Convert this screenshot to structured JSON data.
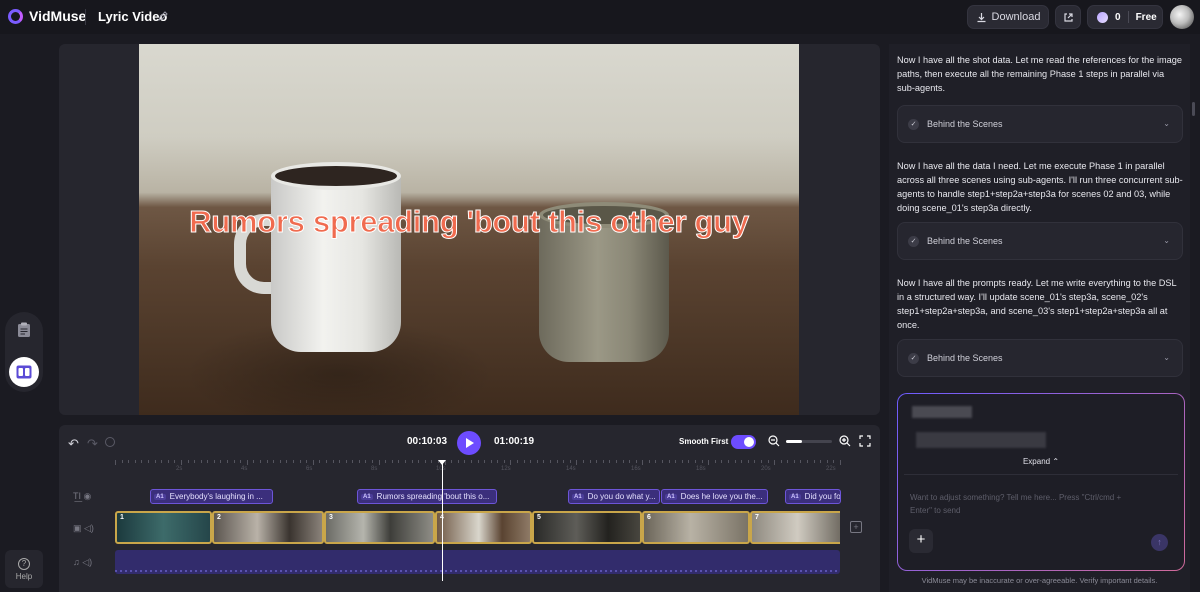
{
  "app": {
    "name": "VidMuse",
    "project_title": "Lyric Video"
  },
  "header": {
    "download_label": "Download",
    "credits": "0",
    "plan": "Free"
  },
  "left_rail": {
    "help_label": "Help"
  },
  "preview": {
    "lyric_overlay": "Rumors spreading 'bout this other guy"
  },
  "timeline": {
    "current_time": "00:10:03",
    "total_time": "01:00:19",
    "smooth_first_label": "Smooth First",
    "smooth_first_on": true,
    "zoom_level": 0.35,
    "lyric_chips": [
      {
        "tag": "A⃣",
        "text": "Everybody's laughing in ..."
      },
      {
        "tag": "A⃣",
        "text": "Rumors spreading 'bout this o..."
      },
      {
        "tag": "A⃣",
        "text": "Do you do what y..."
      },
      {
        "tag": "A⃣",
        "text": "Does he love you the..."
      },
      {
        "tag": "A⃣",
        "text": "Did you for"
      }
    ],
    "clips": [
      {
        "num": "1"
      },
      {
        "num": "2"
      },
      {
        "num": "3"
      },
      {
        "num": "4"
      },
      {
        "num": "5"
      },
      {
        "num": "6"
      },
      {
        "num": "7"
      }
    ],
    "ruler_labels": [
      "2s",
      "4s",
      "6s",
      "8s",
      "10s",
      "12s",
      "14s",
      "16s",
      "18s",
      "20s",
      "22s"
    ]
  },
  "chat": {
    "messages": [
      "Now I have all the shot data. Let me read the references for the image paths, then execute all the remaining Phase 1 steps in parallel via sub-agents.",
      "Now I have all the data I need. Let me execute Phase 1 in parallel across all three scenes using sub-agents. I'll run three concurrent sub-agents to handle step1+step2a+step3a for scenes 02 and 03, while doing scene_01's step3a directly.",
      "Now I have all the prompts ready. Let me write everything to the DSL in a structured way. I'll update scene_01's step3a, scene_02's step1+step2a+step3a, and scene_03's step1+step2a+step3a all at once."
    ],
    "behind_scenes_label": "Behind the Scenes",
    "expand_label": "Expand",
    "input_placeholder": "Want to adjust something? Tell me here... Press \"Ctrl/cmd + Enter\" to send",
    "disclaimer": "VidMuse may be inaccurate or over-agreeable. Verify important details."
  },
  "colors": {
    "accent": "#6d4cff",
    "lyric": "#f06b4f",
    "clip_border": "#c9a64a"
  }
}
